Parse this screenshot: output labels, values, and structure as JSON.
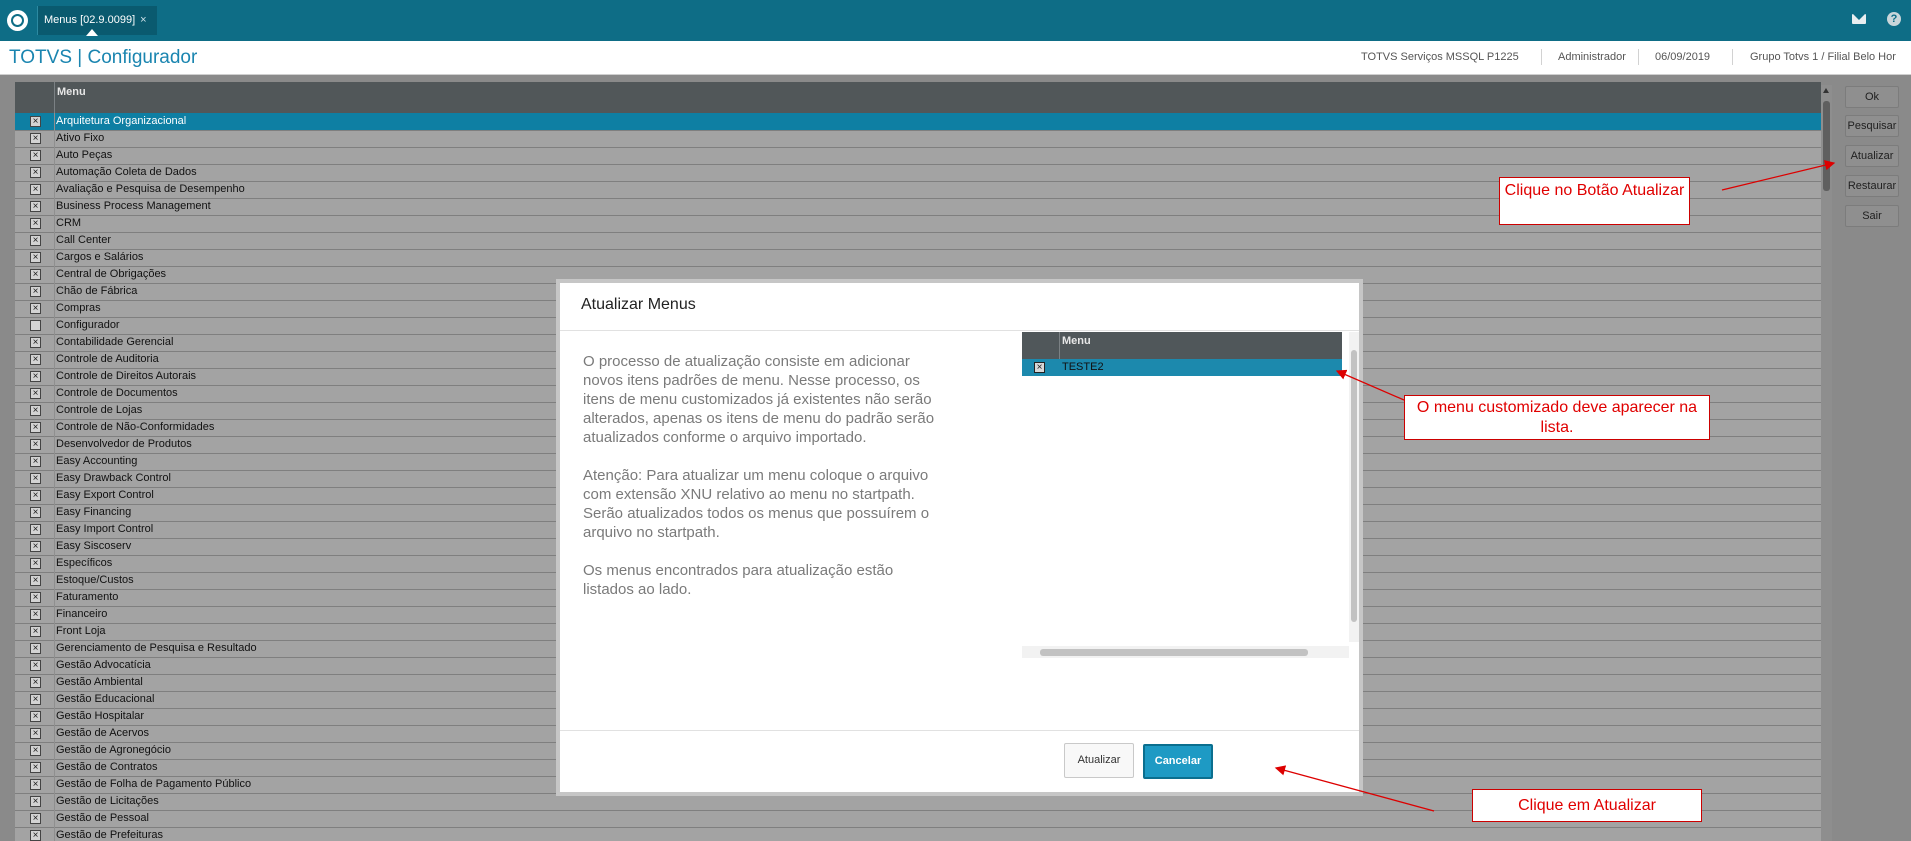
{
  "topbar": {
    "tab_label": "Menus [02.9.0099]",
    "tab_close": "×"
  },
  "header": {
    "app_title": "TOTVS | Configurador",
    "server": "TOTVS Serviços MSSQL P1225",
    "user": "Administrador",
    "date": "06/09/2019",
    "company": "Grupo Totvs 1 / Filial Belo Hor"
  },
  "grid": {
    "column_header": "Menu",
    "rows": [
      {
        "label": "Arquitetura Organizacional",
        "checked": true
      },
      {
        "label": "Ativo Fixo",
        "checked": true
      },
      {
        "label": "Auto Peças",
        "checked": true
      },
      {
        "label": "Automação Coleta de Dados",
        "checked": true
      },
      {
        "label": "Avaliação e Pesquisa de Desempenho",
        "checked": true
      },
      {
        "label": "Business Process Management",
        "checked": true
      },
      {
        "label": "CRM",
        "checked": true
      },
      {
        "label": "Call Center",
        "checked": true
      },
      {
        "label": "Cargos e Salários",
        "checked": true
      },
      {
        "label": "Central de Obrigações",
        "checked": true
      },
      {
        "label": "Chão de Fábrica",
        "checked": true
      },
      {
        "label": "Compras",
        "checked": true
      },
      {
        "label": "Configurador",
        "checked": false
      },
      {
        "label": "Contabilidade Gerencial",
        "checked": true
      },
      {
        "label": "Controle de Auditoria",
        "checked": true
      },
      {
        "label": "Controle de Direitos Autorais",
        "checked": true
      },
      {
        "label": "Controle de Documentos",
        "checked": true
      },
      {
        "label": "Controle de Lojas",
        "checked": true
      },
      {
        "label": "Controle de Não-Conformidades",
        "checked": true
      },
      {
        "label": "Desenvolvedor de Produtos",
        "checked": true
      },
      {
        "label": "Easy Accounting",
        "checked": true
      },
      {
        "label": "Easy Drawback Control",
        "checked": true
      },
      {
        "label": "Easy Export Control",
        "checked": true
      },
      {
        "label": "Easy Financing",
        "checked": true
      },
      {
        "label": "Easy Import Control",
        "checked": true
      },
      {
        "label": "Easy Siscoserv",
        "checked": true
      },
      {
        "label": "Específicos",
        "checked": true
      },
      {
        "label": "Estoque/Custos",
        "checked": true
      },
      {
        "label": "Faturamento",
        "checked": true
      },
      {
        "label": "Financeiro",
        "checked": true
      },
      {
        "label": "Front Loja",
        "checked": true
      },
      {
        "label": "Gerenciamento de Pesquisa e Resultado",
        "checked": true
      },
      {
        "label": "Gestão Advocatícia",
        "checked": true
      },
      {
        "label": "Gestão Ambiental",
        "checked": true
      },
      {
        "label": "Gestão Educacional",
        "checked": true
      },
      {
        "label": "Gestão Hospitalar",
        "checked": true
      },
      {
        "label": "Gestão de Acervos",
        "checked": true
      },
      {
        "label": "Gestão de Agronegócio",
        "checked": true
      },
      {
        "label": "Gestão de Contratos",
        "checked": true
      },
      {
        "label": "Gestão de Folha de Pagamento Público",
        "checked": true
      },
      {
        "label": "Gestão de Licitações",
        "checked": true
      },
      {
        "label": "Gestão de Pessoal",
        "checked": true
      },
      {
        "label": "Gestão de Prefeituras",
        "checked": true
      }
    ]
  },
  "side_buttons": {
    "ok": "Ok",
    "pesquisar": "Pesquisar",
    "atualizar": "Atualizar",
    "restaurar": "Restaurar",
    "sair": "Sair"
  },
  "dialog": {
    "title": "Atualizar Menus",
    "paragraph1": "O processo de atualização consiste em adicionar novos itens padrões de menu. Nesse processo, os itens de menu customizados já existentes não serão alterados, apenas os itens de menu do padrão serão atualizados conforme o arquivo importado.",
    "paragraph2": "Atenção: Para atualizar um menu coloque o arquivo com extensão XNU relativo ao menu no startpath.\nSerão atualizados todos os menus que possuírem o arquivo no startpath.",
    "paragraph3": "Os menus encontrados para atualização estão listados ao lado.",
    "grid_header": "Menu",
    "grid_row": "TESTE2",
    "btn_atualizar": "Atualizar",
    "btn_cancelar": "Cancelar"
  },
  "callouts": {
    "top": "Clique no Botão Atualizar",
    "middle": "O menu customizado deve aparecer na lista.",
    "bottom": "Clique em Atualizar"
  },
  "colors": {
    "topbar": "#0e6d86",
    "title": "#1a85b0",
    "selected_row": "#0e7fa3",
    "callout_text": "#e00000"
  }
}
